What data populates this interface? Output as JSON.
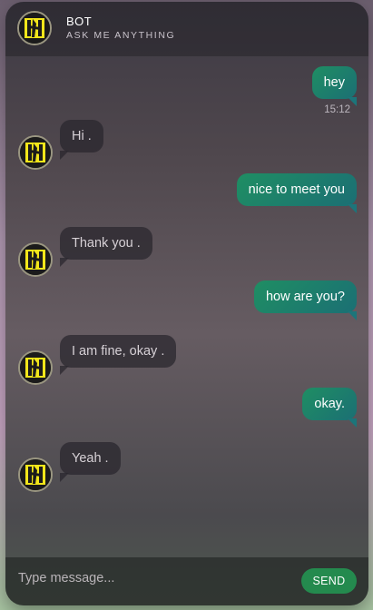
{
  "header": {
    "title": "BOT",
    "subtitle": "ASK ME ANYTHING"
  },
  "messages": [
    {
      "from": "user",
      "text": "hey",
      "time": "15:12"
    },
    {
      "from": "bot",
      "text": "Hi ."
    },
    {
      "from": "user",
      "text": "nice to meet you"
    },
    {
      "from": "bot",
      "text": "Thank you ."
    },
    {
      "from": "user",
      "text": "how are you?"
    },
    {
      "from": "bot",
      "text": "I am fine, okay ."
    },
    {
      "from": "user",
      "text": "okay."
    },
    {
      "from": "bot",
      "text": "Yeah ."
    }
  ],
  "composer": {
    "placeholder": "Type message...",
    "send_label": "SEND"
  },
  "colors": {
    "user_bubble": "#1f8e63",
    "send_button": "#248a4e",
    "avatar_accent": "#f2e61a"
  }
}
